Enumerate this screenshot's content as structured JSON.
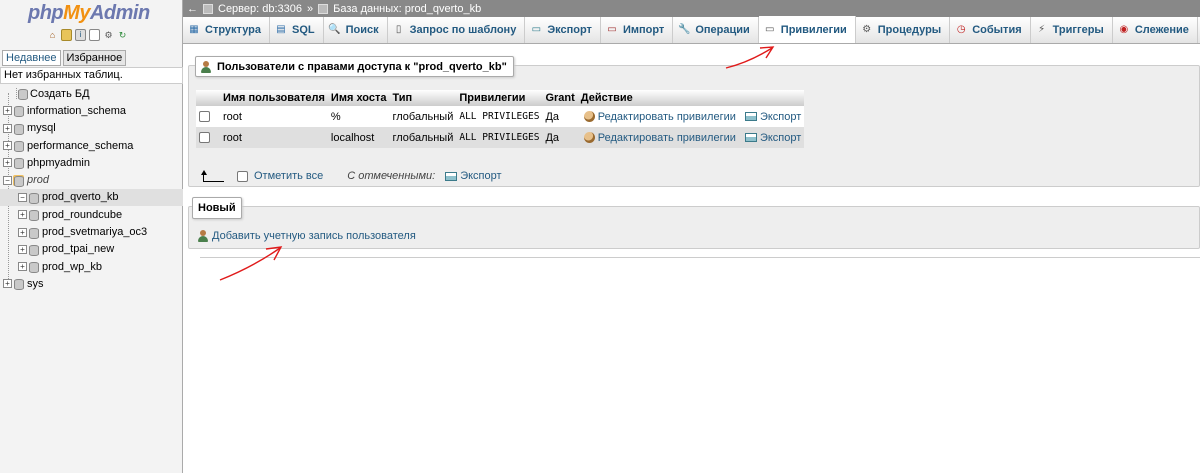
{
  "logo": {
    "php": "php",
    "my": "My",
    "admin": "Admin"
  },
  "sidebar": {
    "recent_tab": "Недавнее",
    "favorites_tab": "Избранное",
    "favorites_empty": "Нет избранных таблиц.",
    "create_db": "Создать БД",
    "databases": [
      {
        "name": "information_schema"
      },
      {
        "name": "mysql"
      },
      {
        "name": "performance_schema"
      },
      {
        "name": "phpmyadmin"
      }
    ],
    "group": "prod",
    "group_children": [
      {
        "name": "prod_qverto_kb"
      },
      {
        "name": "prod_roundcube"
      },
      {
        "name": "prod_svetmariya_oc3"
      },
      {
        "name": "prod_tpai_new"
      },
      {
        "name": "prod_wp_kb"
      }
    ],
    "last_db": "sys"
  },
  "breadcrumb": {
    "server": "Сервер: db:3306",
    "separator": "»",
    "database": "База данных: prod_qverto_kb"
  },
  "tabs": [
    {
      "label": "Структура",
      "icon": "structure-icon"
    },
    {
      "label": "SQL",
      "icon": "sql-icon"
    },
    {
      "label": "Поиск",
      "icon": "search-icon"
    },
    {
      "label": "Запрос по шаблону",
      "icon": "query-icon"
    },
    {
      "label": "Экспорт",
      "icon": "export-icon"
    },
    {
      "label": "Импорт",
      "icon": "import-icon"
    },
    {
      "label": "Операции",
      "icon": "wrench-icon"
    },
    {
      "label": "Привилегии",
      "icon": "privileges-icon",
      "active": true
    },
    {
      "label": "Процедуры",
      "icon": "routines-icon"
    },
    {
      "label": "События",
      "icon": "events-icon"
    },
    {
      "label": "Триггеры",
      "icon": "triggers-icon"
    },
    {
      "label": "Слежение",
      "icon": "eye-icon"
    }
  ],
  "users_section": {
    "legend_prefix": "Пользователи с правами доступа к \"",
    "legend_db": "prod_qverto_kb",
    "legend_suffix": "\"",
    "columns": [
      "Имя пользователя",
      "Имя хоста",
      "Тип",
      "Привилегии",
      "Grant",
      "Действие"
    ],
    "rows": [
      {
        "user": "root",
        "host": "%",
        "type": "глобальный",
        "privileges": "ALL PRIVILEGES",
        "grant": "Да",
        "edit": "Редактировать привилегии",
        "export": "Экспорт"
      },
      {
        "user": "root",
        "host": "localhost",
        "type": "глобальный",
        "privileges": "ALL PRIVILEGES",
        "grant": "Да",
        "edit": "Редактировать привилегии",
        "export": "Экспорт"
      }
    ],
    "check_all": "Отметить все",
    "with_selected": "С отмеченными:",
    "bulk_export": "Экспорт"
  },
  "new_section": {
    "legend": "Новый",
    "add_user": "Добавить учетную запись пользователя"
  },
  "colors": {
    "link": "#235a81",
    "breadcrumb_bg": "#888888",
    "annotation": "#e01a1a"
  }
}
